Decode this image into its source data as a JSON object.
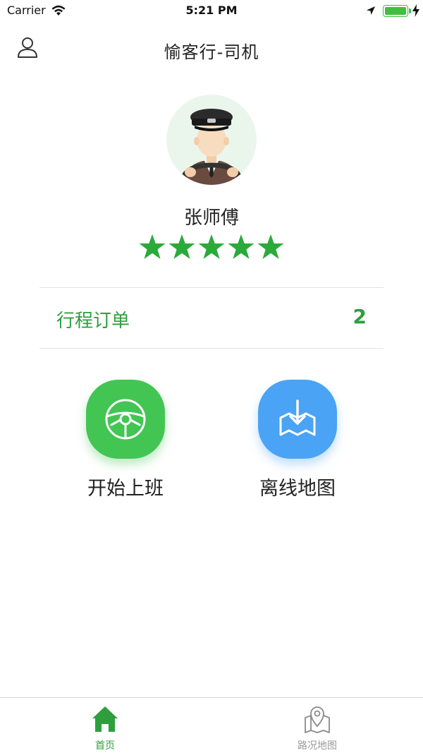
{
  "status_bar": {
    "carrier": "Carrier",
    "time": "5:21 PM",
    "icons": [
      "wifi-icon",
      "location-arrow-icon",
      "battery-icon",
      "charging-icon"
    ]
  },
  "nav": {
    "title": "愉客行-司机",
    "left_icon": "user-profile-icon"
  },
  "driver": {
    "name": "张师傅",
    "rating": 5,
    "rating_max": 5,
    "avatar_icon": "driver-avatar"
  },
  "orders": {
    "label": "行程订单",
    "count": "2"
  },
  "actions": [
    {
      "label": "开始上班",
      "icon": "steering-wheel-icon",
      "color": "#43c553"
    },
    {
      "label": "离线地图",
      "icon": "map-download-icon",
      "color": "#4aa3f4"
    }
  ],
  "tabs": [
    {
      "label": "首页",
      "icon": "home-icon",
      "active": true
    },
    {
      "label": "路况地图",
      "icon": "map-pin-icon",
      "active": false
    }
  ],
  "colors": {
    "accent_green": "#2e9f3c",
    "tab_active": "#2e9f3c",
    "tab_inactive": "#9a9a9a",
    "star": "#2aaa3a"
  }
}
